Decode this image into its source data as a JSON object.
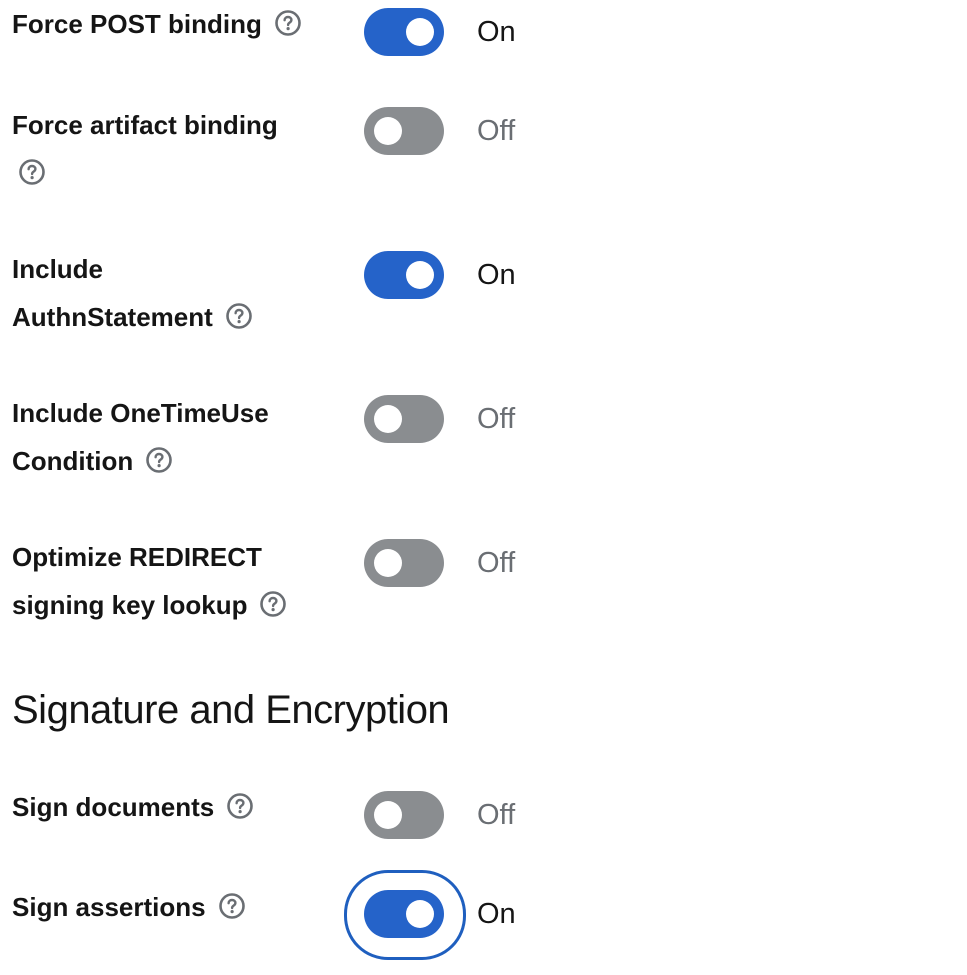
{
  "settings": [
    {
      "label": "Force POST binding",
      "state": "On"
    },
    {
      "label": "Force artifact binding",
      "state": "Off"
    },
    {
      "label": "Include AuthnStatement",
      "state": "On"
    },
    {
      "label": "Include OneTimeUse Condition",
      "state": "Off"
    },
    {
      "label": "Optimize REDIRECT signing key lookup",
      "state": "Off"
    }
  ],
  "section": {
    "title": "Signature and Encryption",
    "settings": [
      {
        "label": "Sign documents",
        "state": "Off"
      },
      {
        "label": "Sign assertions",
        "state": "On"
      }
    ]
  },
  "icons": {
    "help": "help-circle-icon"
  },
  "colors": {
    "switch_on": "#2563c9",
    "switch_off": "#8a8d90",
    "focus_ring": "#1f5fbf",
    "text": "#151515",
    "off_text": "#6a6e73"
  }
}
